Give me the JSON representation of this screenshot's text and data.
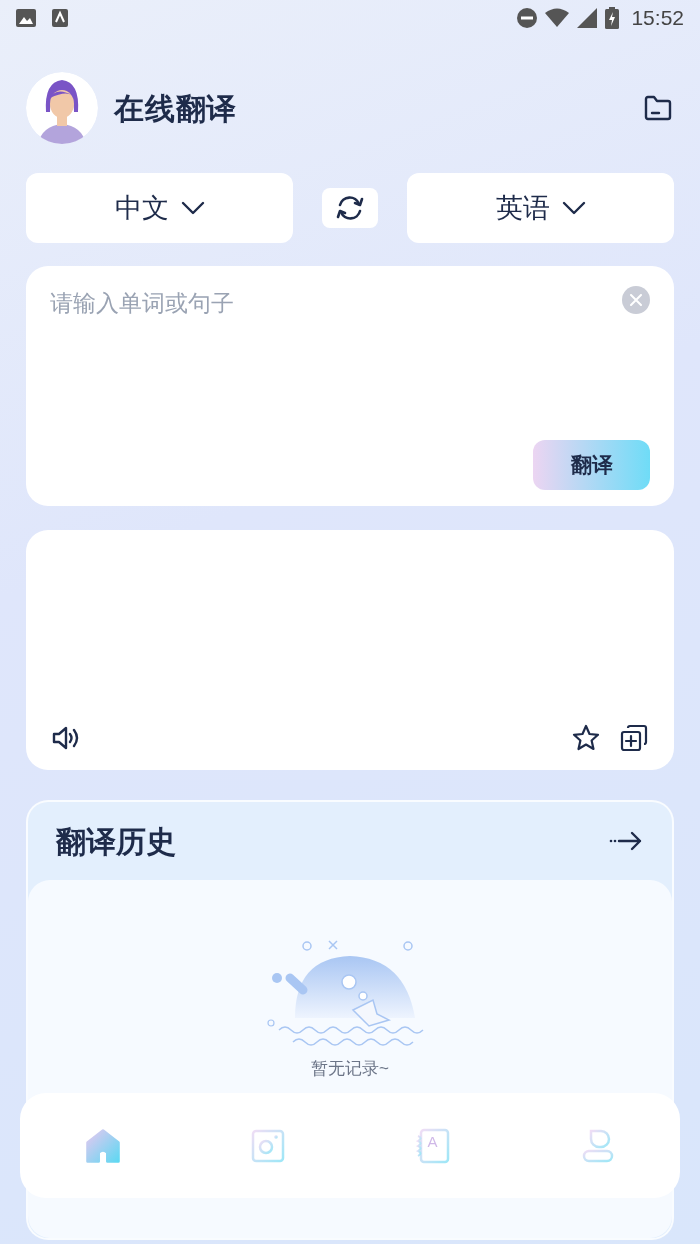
{
  "status_bar": {
    "time": "15:52"
  },
  "header": {
    "title": "在线翻译"
  },
  "languages": {
    "source": "中文",
    "target": "英语"
  },
  "input": {
    "placeholder": "请输入单词或句子",
    "button": "翻译"
  },
  "history": {
    "title": "翻译历史",
    "empty_text": "暂无记录~"
  },
  "nav": [
    {
      "kind": "home",
      "selected": true
    },
    {
      "kind": "camera",
      "selected": false
    },
    {
      "kind": "dictionary",
      "selected": false,
      "glyph": "A"
    },
    {
      "kind": "profile",
      "selected": false
    }
  ]
}
